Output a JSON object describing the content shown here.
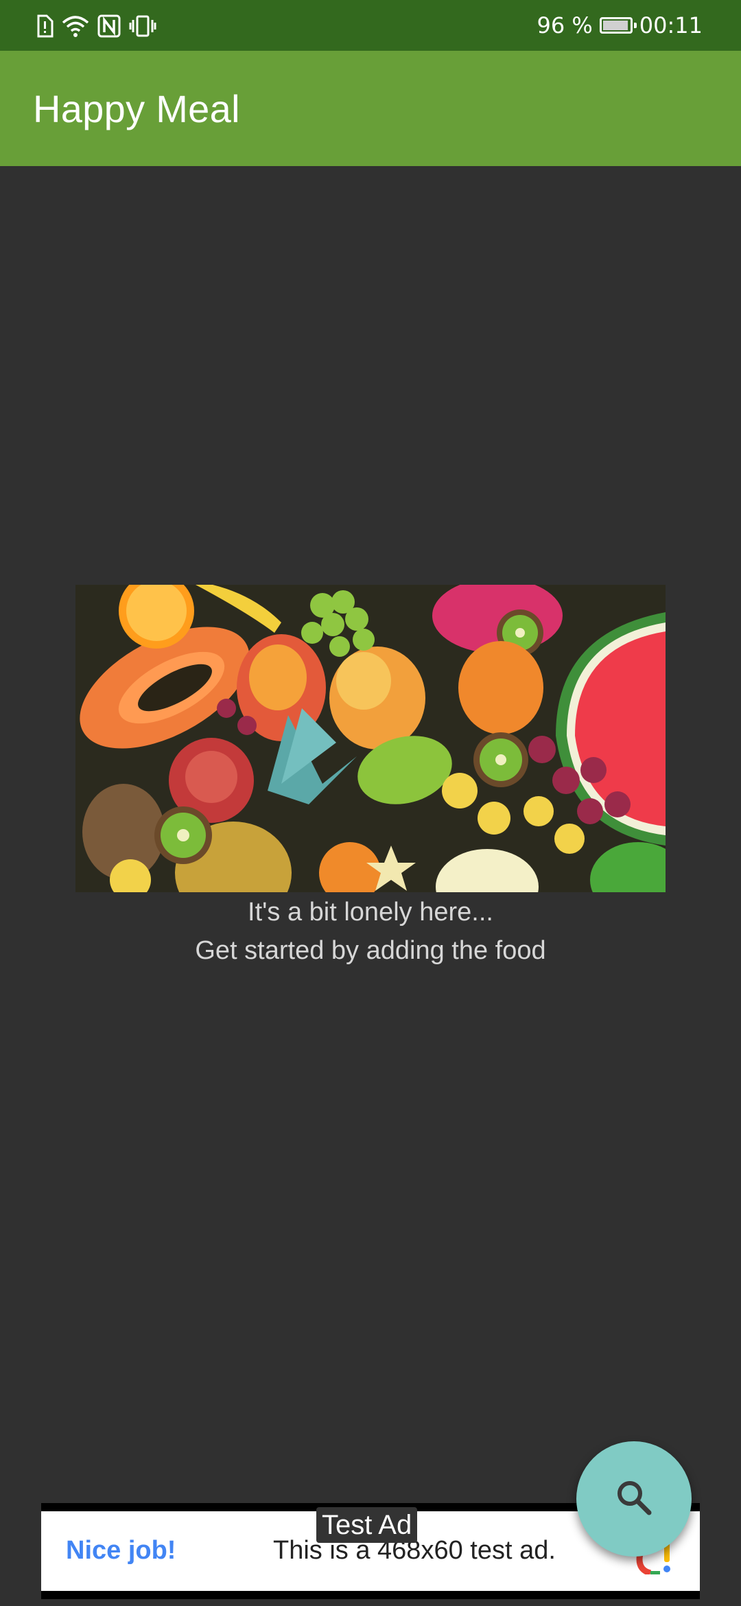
{
  "status_bar": {
    "battery_text": "96 %",
    "battery_level": 0.96,
    "time": "00:11",
    "icons": [
      "sim-alert-icon",
      "wifi-icon",
      "nfc-icon",
      "vibrate-icon",
      "battery-charging-icon"
    ],
    "bg_color": "#33691e"
  },
  "app_bar": {
    "title": "Happy Meal",
    "bg_color": "#689f38"
  },
  "empty_state": {
    "image_desc": "fruit-assortment-image",
    "line1": "It's a bit lonely here...",
    "line2": "Get started by adding the food"
  },
  "fab": {
    "icon": "search-icon",
    "color": "#80cbc4"
  },
  "ad": {
    "label": "Test Ad",
    "headline": "Nice job!",
    "text": "This is a 468x60 test ad.",
    "headline_color": "#4285f4"
  }
}
